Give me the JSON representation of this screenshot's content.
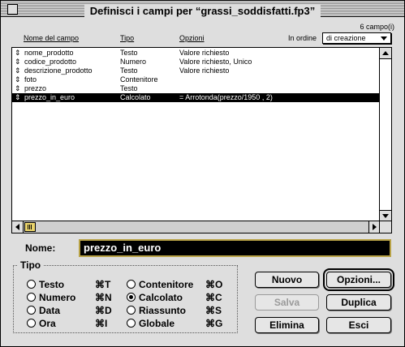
{
  "window": {
    "title": "Definisci i campi per “grassi_soddisfatti.fp3”"
  },
  "count_text": "6 campo(i)",
  "columns": {
    "name": "Nome del campo",
    "type": "Tipo",
    "options": "Opzioni"
  },
  "sort": {
    "label": "In ordine",
    "value": "di creazione"
  },
  "fields": [
    {
      "handle": "⇕",
      "name": "nome_prodotto",
      "type": "Testo",
      "options": "Valore richiesto",
      "selected": false
    },
    {
      "handle": "⇕",
      "name": "codice_prodotto",
      "type": "Numero",
      "options": "Valore richiesto, Unico",
      "selected": false
    },
    {
      "handle": "⇕",
      "name": "descrizione_prodotto",
      "type": "Testo",
      "options": "Valore richiesto",
      "selected": false
    },
    {
      "handle": "⇕",
      "name": "foto",
      "type": "Contenitore",
      "options": "",
      "selected": false
    },
    {
      "handle": "⇕",
      "name": "prezzo",
      "type": "Testo",
      "options": "",
      "selected": false
    },
    {
      "handle": "⇕",
      "name": "prezzo_in_euro",
      "type": "Calcolato",
      "options": "= Arrotonda(prezzo/1950 , 2)",
      "selected": true
    }
  ],
  "name_field": {
    "label": "Nome:",
    "value": "prezzo_in_euro"
  },
  "type_group": {
    "label": "Tipo",
    "options": [
      {
        "label": "Testo",
        "shortcut": "⌘T",
        "checked": false
      },
      {
        "label": "Numero",
        "shortcut": "⌘N",
        "checked": false
      },
      {
        "label": "Data",
        "shortcut": "⌘D",
        "checked": false
      },
      {
        "label": "Ora",
        "shortcut": "⌘I",
        "checked": false
      },
      {
        "label": "Contenitore",
        "shortcut": "⌘O",
        "checked": false
      },
      {
        "label": "Calcolato",
        "shortcut": "⌘C",
        "checked": true
      },
      {
        "label": "Riassunto",
        "shortcut": "⌘S",
        "checked": false
      },
      {
        "label": "Globale",
        "shortcut": "⌘G",
        "checked": false
      }
    ]
  },
  "buttons": {
    "nuovo": "Nuovo",
    "opzioni": "Opzioni...",
    "salva": "Salva",
    "duplica": "Duplica",
    "elimina": "Elimina",
    "esci": "Esci"
  }
}
